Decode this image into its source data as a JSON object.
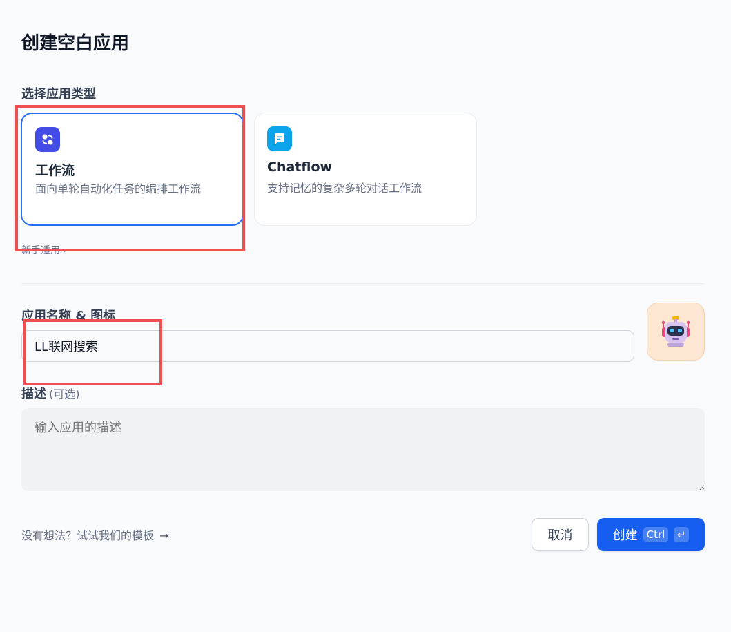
{
  "title": "创建空白应用",
  "app_type": {
    "label": "选择应用类型",
    "cards": [
      {
        "title": "工作流",
        "desc": "面向单轮自动化任务的编排工作流",
        "icon": "workflow-icon",
        "selected": true
      },
      {
        "title": "Chatflow",
        "desc": "支持记忆的复杂多轮对话工作流",
        "icon": "chatflow-icon",
        "selected": false
      }
    ],
    "hint": "新手适用",
    "hint_arrow": "›"
  },
  "name_icon": {
    "label": "应用名称 & 图标",
    "value": "LL联网搜索",
    "avatar_icon": "robot-icon"
  },
  "description": {
    "label": "描述",
    "optional": "(可选)",
    "placeholder": "输入应用的描述"
  },
  "footer": {
    "template_link": "没有想法？试试我们的模板",
    "template_arrow": "→",
    "cancel": "取消",
    "create": "创建",
    "shortcut": "Ctrl",
    "enter_key": "↵"
  },
  "colors": {
    "primary": "#155eef",
    "selected_border": "#296dff",
    "annotation": "#ef4f4f",
    "workflow_icon_bg": "#444ce7",
    "chatflow_icon_bg": "#0ba5ec"
  }
}
